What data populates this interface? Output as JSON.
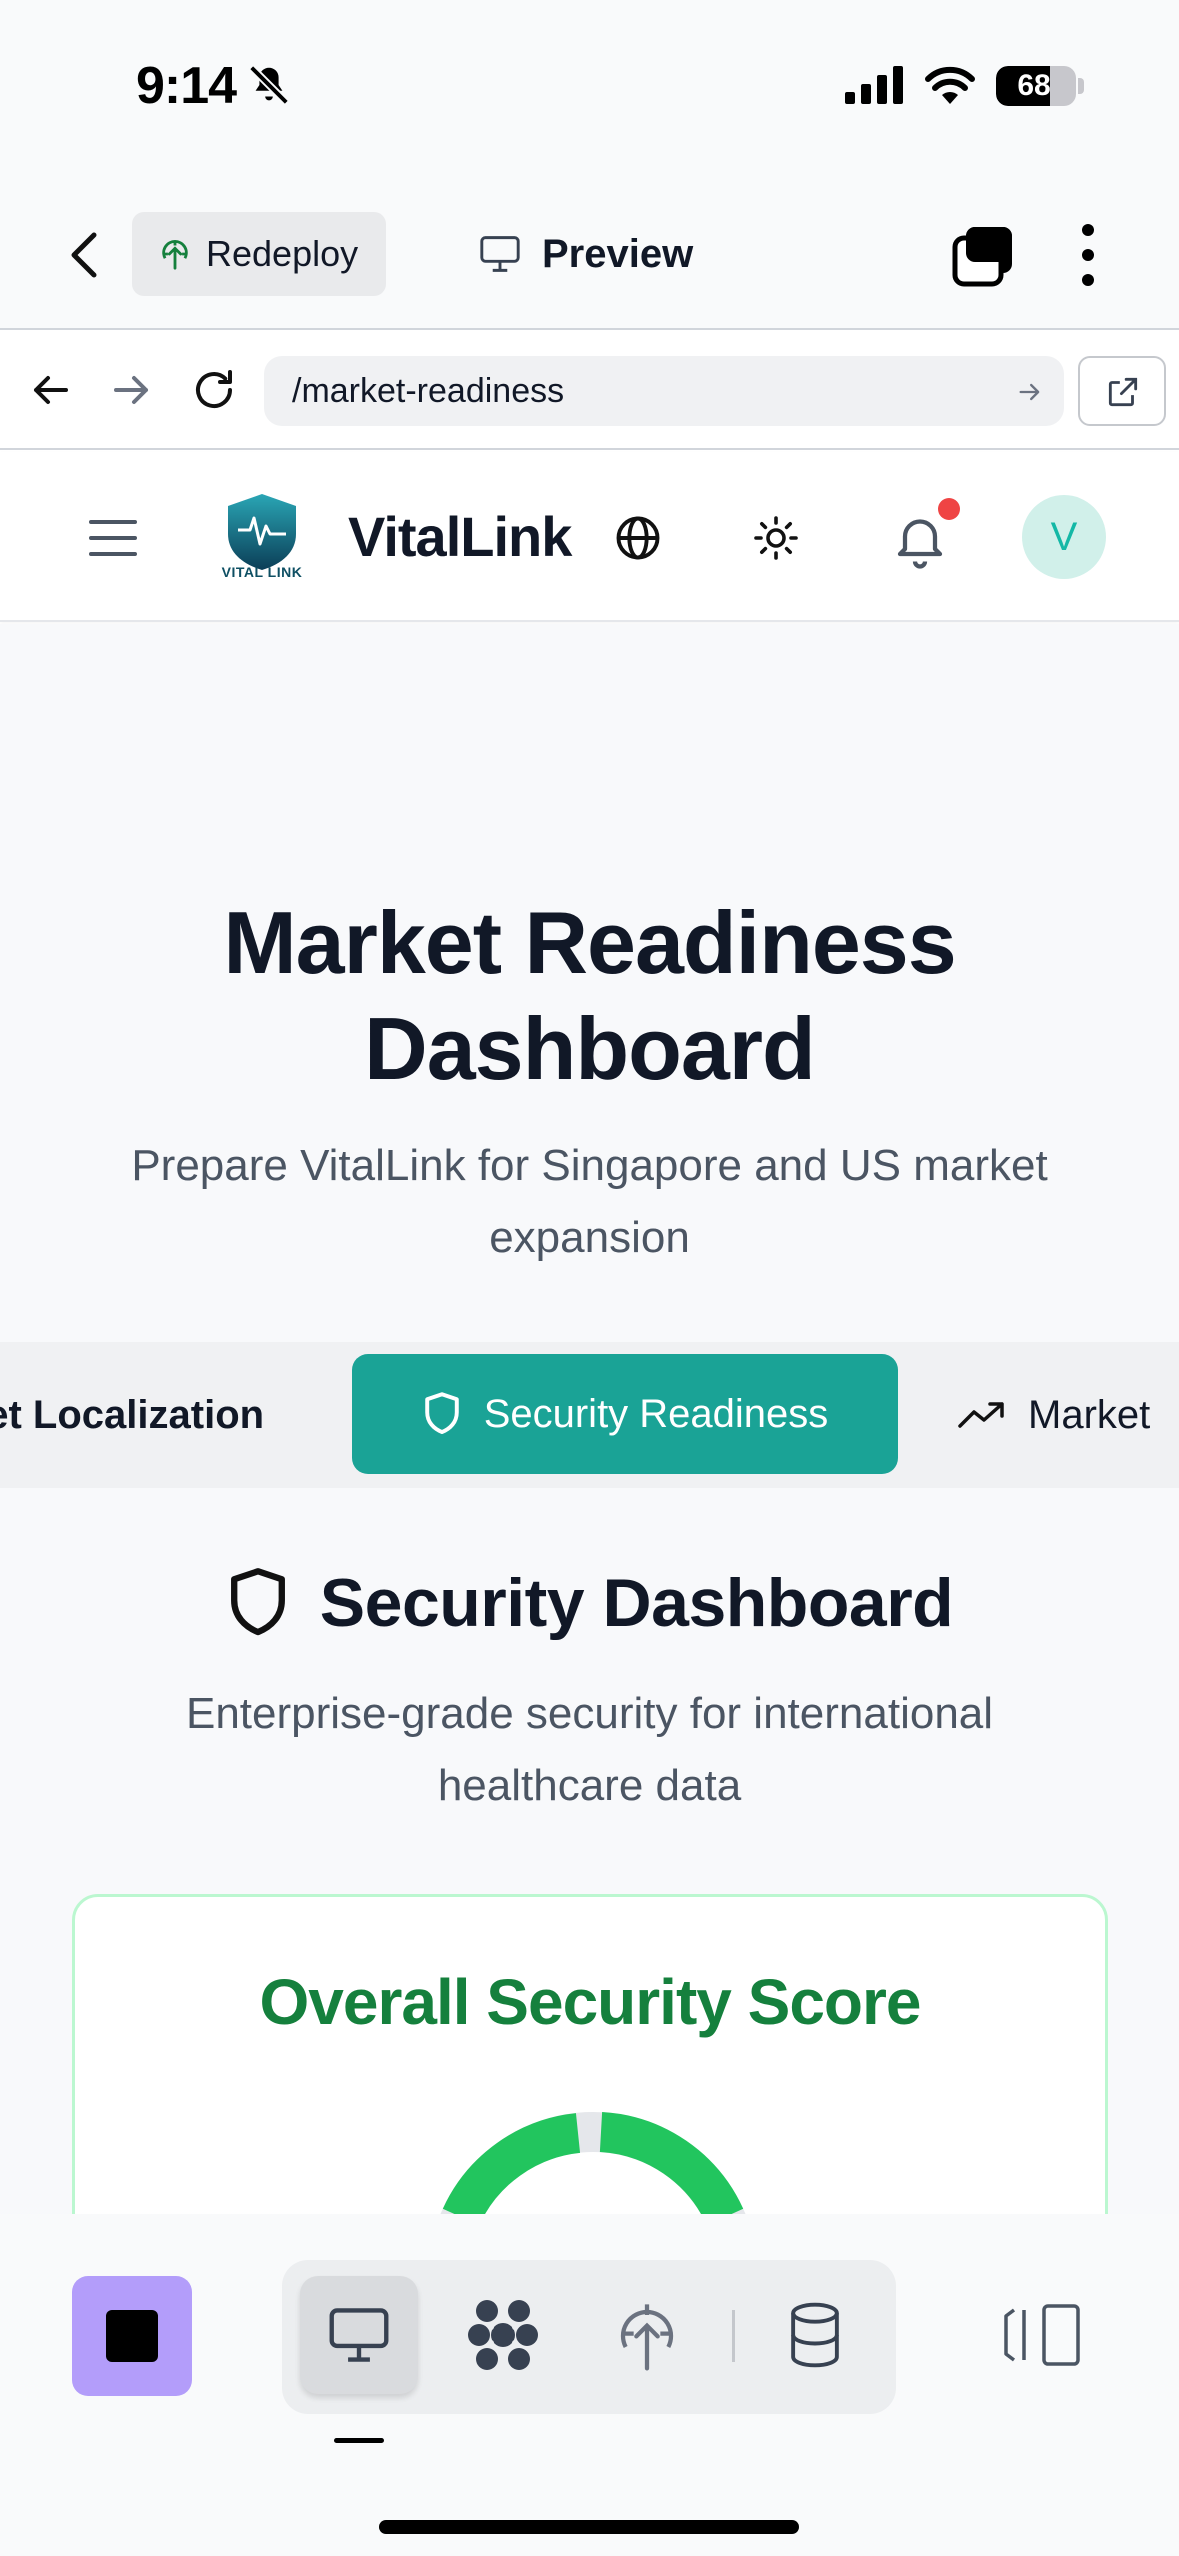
{
  "status_bar": {
    "time": "9:14",
    "battery": "68",
    "battery_level": 0.68
  },
  "toolbar": {
    "redeploy_label": "Redeploy",
    "preview_label": "Preview"
  },
  "url_bar": {
    "url": "/market-readiness"
  },
  "header": {
    "brand": "VitalLink",
    "logo_text": "VITAL LINK",
    "avatar_initial": "V",
    "has_notification": true
  },
  "hero": {
    "title_line1": "Market Readiness",
    "title_line2": "Dashboard",
    "subtitle_line1": "Prepare VitalLink for Singapore and US market",
    "subtitle_line2": "expansion"
  },
  "tabs": [
    {
      "label": "ket Localization",
      "active": false
    },
    {
      "label": "Security Readiness",
      "active": true
    },
    {
      "label": "Market",
      "active": false
    }
  ],
  "security": {
    "title": "Security Dashboard",
    "subtitle_line1": "Enterprise-grade security for international",
    "subtitle_line2": "healthcare data",
    "score_title": "Overall Security Score"
  },
  "colors": {
    "accent": "#1aa396",
    "score_green": "#15803d",
    "gauge_green": "#22c55e",
    "stop_purple": "#b39dfa",
    "notification": "#ef4444"
  },
  "icons": {
    "bottom_bar": [
      "monitor-icon",
      "flower-icon",
      "deploy-icon",
      "database-icon",
      "panel-toggle-icon"
    ]
  }
}
